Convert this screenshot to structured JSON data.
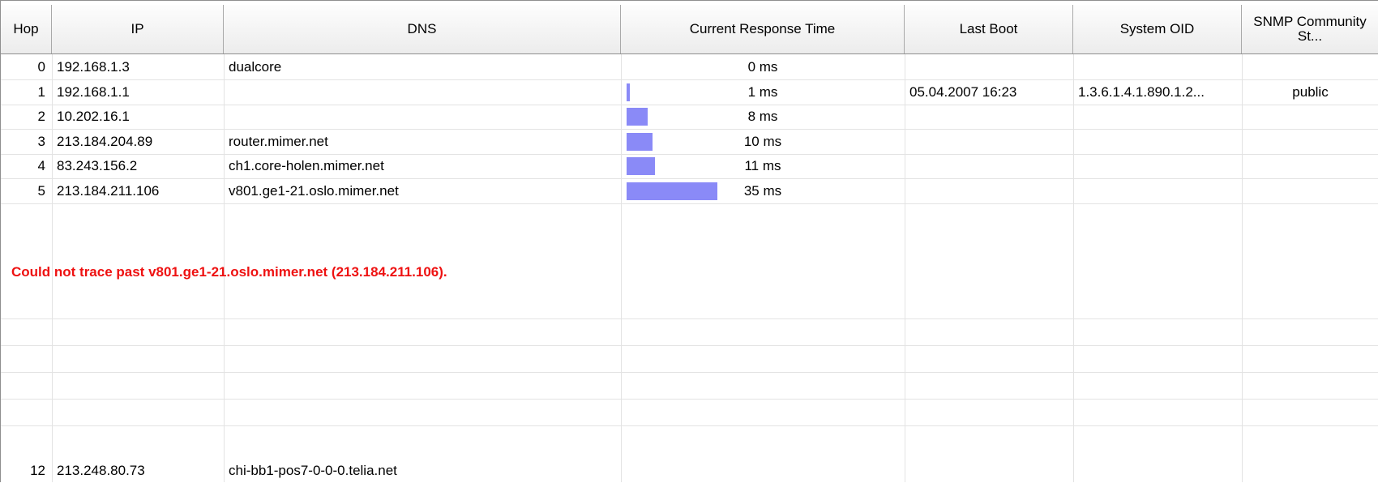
{
  "columns": [
    {
      "key": "hop",
      "label": "Hop"
    },
    {
      "key": "ip",
      "label": "IP"
    },
    {
      "key": "dns",
      "label": "DNS"
    },
    {
      "key": "response",
      "label": "Current Response Time"
    },
    {
      "key": "boot",
      "label": "Last Boot"
    },
    {
      "key": "oid",
      "label": "System OID"
    },
    {
      "key": "snmp",
      "label": "SNMP Community St..."
    }
  ],
  "rows": [
    {
      "hop": "0",
      "ip": "192.168.1.3",
      "dns": "dualcore",
      "response": "0 ms",
      "response_ms": 0,
      "boot": "",
      "oid": "",
      "snmp": ""
    },
    {
      "hop": "1",
      "ip": "192.168.1.1",
      "dns": "",
      "response": "1 ms",
      "response_ms": 1,
      "boot": "05.04.2007 16:23",
      "oid": "1.3.6.1.4.1.890.1.2...",
      "snmp": "public"
    },
    {
      "hop": "2",
      "ip": "10.202.16.1",
      "dns": "",
      "response": "8 ms",
      "response_ms": 8,
      "boot": "",
      "oid": "",
      "snmp": ""
    },
    {
      "hop": "3",
      "ip": "213.184.204.89",
      "dns": "router.mimer.net",
      "response": "10 ms",
      "response_ms": 10,
      "boot": "",
      "oid": "",
      "snmp": ""
    },
    {
      "hop": "4",
      "ip": "83.243.156.2",
      "dns": "ch1.core-holen.mimer.net",
      "response": "11 ms",
      "response_ms": 11,
      "boot": "",
      "oid": "",
      "snmp": ""
    },
    {
      "hop": "5",
      "ip": "213.184.211.106",
      "dns": "v801.ge1-21.oslo.mimer.net",
      "response": "35 ms",
      "response_ms": 35,
      "boot": "",
      "oid": "",
      "snmp": ""
    }
  ],
  "trace_error": "Could not trace past v801.ge1-21.oslo.mimer.net (213.184.211.106).",
  "last_row": {
    "hop": "12",
    "ip": "213.248.80.73",
    "dns": "chi-bb1-pos7-0-0-0.telia.net",
    "response": "",
    "boot": "",
    "oid": "",
    "snmp": ""
  },
  "bar_color": "#8a8af7",
  "error_color": "#ee1111"
}
